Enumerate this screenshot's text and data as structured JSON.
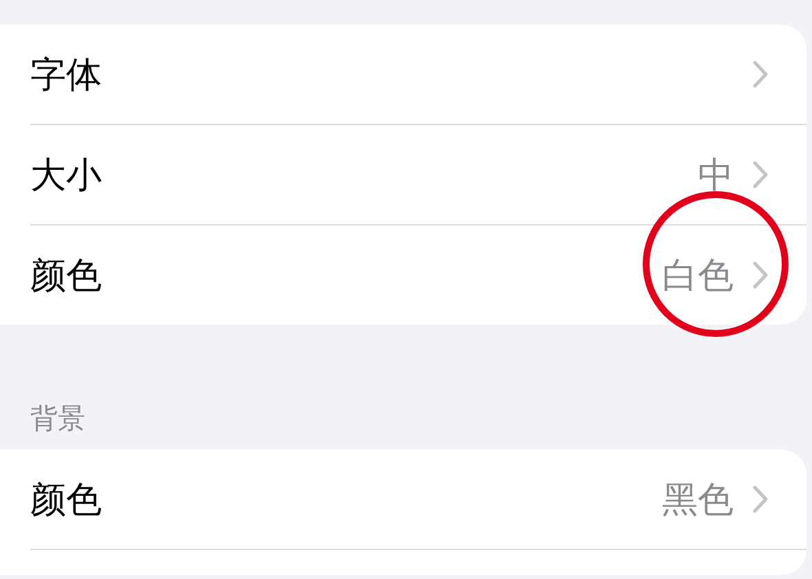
{
  "sections": [
    {
      "rows": [
        {
          "label": "字体",
          "circled": false
        },
        {
          "label": "大小",
          "value": "中",
          "circled": false
        },
        {
          "label": "颜色",
          "value": "白色",
          "circled": true
        }
      ]
    },
    {
      "header": "背景",
      "rows": [
        {
          "label": "颜色",
          "value": "黑色",
          "circled": false
        }
      ]
    }
  ]
}
